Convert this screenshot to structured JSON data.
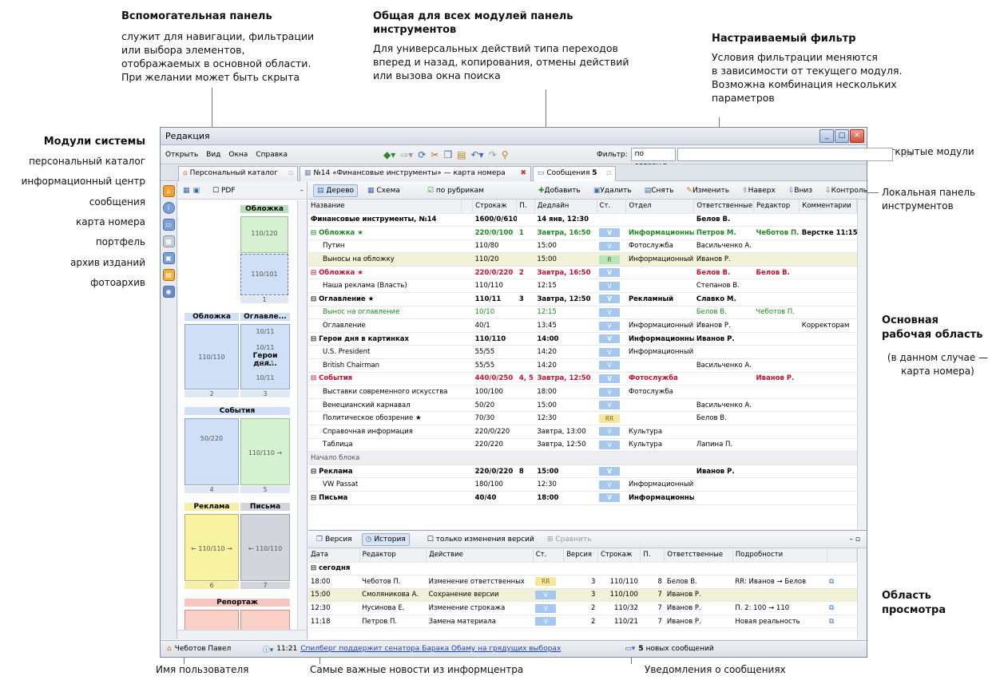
{
  "annotations": {
    "aux_panel_title": "Вспомогательная панель",
    "aux_panel_text": [
      "служит для навигации, фильтрации",
      "или выбора элементов,",
      "отображаемых в основной области.",
      "При желании может быть скрыта"
    ],
    "common_tb_title": [
      "Общая для всех модулей панель",
      "инструментов"
    ],
    "common_tb_text": [
      "Для универсальных действий типа переходов",
      "вперед и назад, копирования, отмены действий",
      "или вызова окна поиска"
    ],
    "filter_title": "Настраиваемый фильтр",
    "filter_text": [
      "Условия фильтрации меняются",
      "в зависимости от текущего модуля.",
      "Возможна комбинация нескольких",
      "параметров"
    ],
    "modules_title": "Модули системы",
    "modules": [
      "персональный каталог",
      "информационный центр",
      "сообщения",
      "карта номера",
      "портфель",
      "архив изданий",
      "фотоархив"
    ],
    "open_modules": "Открытые модули",
    "local_tb": [
      "Локальная панель",
      "инструментов"
    ],
    "main_area": [
      "Основная",
      "рабочая область"
    ],
    "main_area_note": [
      "(в данном случае —",
      "карта номера)"
    ],
    "preview_area": [
      "Область",
      "просмотра"
    ],
    "user_name_lbl": "Имя пользователя",
    "news_lbl": "Самые важные новости из информцентра",
    "msg_lbl": "Уведомления о сообщениях"
  },
  "window": {
    "title": "Редакция"
  },
  "menu": [
    "Открыть",
    "Вид",
    "Окна",
    "Справка"
  ],
  "filter": {
    "label": "Фильтр:",
    "value": "по автору"
  },
  "tabs": [
    "Персональный каталог",
    "№14 «Финансовые инструменты» — карта номера",
    "Сообщения",
    "5"
  ],
  "nav": {
    "pdf": "PDF",
    "sections": [
      "Обложка",
      "Обложка",
      "Оглавле...",
      "Герои дня...",
      "События",
      "Реклама",
      "Письма",
      "Репортаж"
    ],
    "pages": [
      "1",
      "2",
      "3",
      "4",
      "5",
      "6",
      "7"
    ],
    "sizes": [
      "110/120",
      "110/101",
      "110/110",
      "10/11",
      "10/11",
      "10/11",
      "10/11",
      "50/220",
      "110/110 →",
      "← 110/110 →",
      "← 110/110"
    ]
  },
  "local_toolbar": {
    "tree": "Дерево",
    "scheme": "Схема",
    "by_rubrics": "по рубрикам",
    "add": "Добавить",
    "delete": "Удалить",
    "remove": "Снять",
    "edit": "Изменить",
    "up": "Наверх",
    "down": "Вниз",
    "control": "Контроль"
  },
  "grid": {
    "headers": [
      "Название",
      "",
      "Строкаж",
      "П.",
      "Дедлайн",
      "Ст.",
      "Отдел",
      "Ответственные",
      "Редактор",
      "Комментарии"
    ],
    "rows": [
      [
        "Финансовые инструменты, №14",
        "",
        "1600/0/610",
        "",
        "14 янв, 12:30",
        "",
        "",
        "Белов В.",
        "",
        "",
        "grp"
      ],
      [
        "⊟ Обложка ★",
        "",
        "220/0/100",
        "1",
        "Завтра, 16:50",
        "V",
        "Информационный",
        "Петров М.",
        "Чеботов П.",
        "Верстке 11:15",
        "grp grn"
      ],
      [
        "Путин",
        "",
        "110/80",
        "",
        "15:00",
        "V",
        "Фотослужба",
        "Васильченко А.",
        "",
        "",
        ""
      ],
      [
        "Выносы на обложку",
        "",
        "110/20",
        "",
        "15:00",
        "R",
        "Информационный",
        "Иванов Р.",
        "",
        "",
        "hl"
      ],
      [
        "⊟ Обложка ★",
        "",
        "220/0/220",
        "2",
        "Завтра, 16:50",
        "V",
        "",
        "Белов В.",
        "Белов В.",
        "",
        "grp red"
      ],
      [
        "Наша реклама (Власть)",
        "",
        "110/110",
        "",
        "12:15",
        "V",
        "",
        "Степанов В.",
        "",
        "",
        ""
      ],
      [
        "⊟ Оглавление ★",
        "",
        "110/11",
        "3",
        "Завтра, 12:50",
        "V",
        "Рекламный",
        "Славко М.",
        "",
        "",
        "grp"
      ],
      [
        "Вынос на оглавление",
        "",
        "10/10",
        "",
        "12:15",
        "V",
        "",
        "Белов В.",
        "Чеботов П.",
        "",
        "grn"
      ],
      [
        "Оглавление",
        "",
        "40/1",
        "",
        "13:45",
        "V",
        "Информационный",
        "Иванов Р.",
        "",
        "Корректорам",
        ""
      ],
      [
        "⊟ Герои дня в картинках",
        "",
        "110/110",
        "",
        "14:00",
        "V",
        "Информационный",
        "Иванов Р.",
        "",
        "",
        "grp"
      ],
      [
        "U.S. President",
        "",
        "55/55",
        "",
        "14:20",
        "V",
        "Информационный",
        "",
        "",
        "",
        ""
      ],
      [
        "British Chairman",
        "",
        "55/55",
        "",
        "14:20",
        "V",
        "",
        "Васильченко А.",
        "",
        "",
        ""
      ],
      [
        "⊟ События",
        "",
        "440/0/250",
        "4, 5",
        "Завтра, 12:50",
        "V",
        "Фотослужба",
        "",
        "Иванов Р.",
        "",
        "grp red"
      ],
      [
        "Выставки современного искусства",
        "",
        "100/100",
        "",
        "18:00",
        "V",
        "Фотослужба",
        "",
        "",
        "",
        ""
      ],
      [
        "Венецианский карнавал",
        "",
        "50/20",
        "",
        "15:00",
        "V",
        "",
        "Васильченко А.",
        "",
        "",
        ""
      ],
      [
        "Политическое обозрение ★",
        "",
        "70/30",
        "",
        "12:30",
        "RR",
        "",
        "Белов В.",
        "",
        "",
        ""
      ],
      [
        "Справочная информация",
        "",
        "220/0/220",
        "",
        "Завтра, 13:00",
        "V",
        "Культура",
        "",
        "",
        "",
        ""
      ],
      [
        "Таблица",
        "",
        "220/220",
        "",
        "Завтра, 12:50",
        "V",
        "Культура",
        "Лапина П.",
        "",
        "",
        ""
      ],
      [
        "Начало блока",
        "",
        "",
        "",
        "",
        "",
        "",
        "",
        "",
        "",
        "gray"
      ],
      [
        "⊟ Реклама",
        "",
        "220/0/220",
        "8",
        "15:00",
        "V",
        "",
        "Иванов Р.",
        "",
        "",
        "grp"
      ],
      [
        "VW Passat",
        "",
        "180/100",
        "",
        "12:30",
        "V",
        "Информационный",
        "",
        "",
        "",
        ""
      ],
      [
        "⊟ Письма",
        "",
        "40/40",
        "",
        "18:00",
        "V",
        "Информационный",
        "",
        "",
        "",
        "grp"
      ]
    ]
  },
  "history": {
    "version": "Версия",
    "history": "История",
    "only_changes": "только изменения версий",
    "compare": "Сравнить",
    "headers": [
      "Дата",
      "Редактор",
      "Действие",
      "Ст.",
      "Версия",
      "Строкаж",
      "П.",
      "Ответственные",
      "Подробности"
    ],
    "group": "⊟ сегодня",
    "rows": [
      [
        "18:00",
        "Чеботов П.",
        "Изменение ответственных",
        "RR",
        "3",
        "110/110",
        "8",
        "Белов В.",
        "RR: Иванов → Белов"
      ],
      [
        "15:00",
        "Смоляникова А.",
        "Сохранение версии",
        "V",
        "3",
        "110/100",
        "7",
        "Иванов Р.",
        ""
      ],
      [
        "12:30",
        "Нусинова Е.",
        "Изменение строкажа",
        "V",
        "2",
        "110/32",
        "7",
        "Иванов Р.",
        "П. 2: 100 → 110"
      ],
      [
        "11:18",
        "Петров П.",
        "Замена материала",
        "V",
        "2",
        "110/21",
        "7",
        "Иванов Р.",
        "Новая реальность"
      ]
    ]
  },
  "status": {
    "user": "Чеботов Павел",
    "time": "11:21",
    "news": "Спилберг поддержит сенатора Барака Обаму на грядущих выборах",
    "msg_count": "5",
    "msg_text": "новых сообщений"
  }
}
